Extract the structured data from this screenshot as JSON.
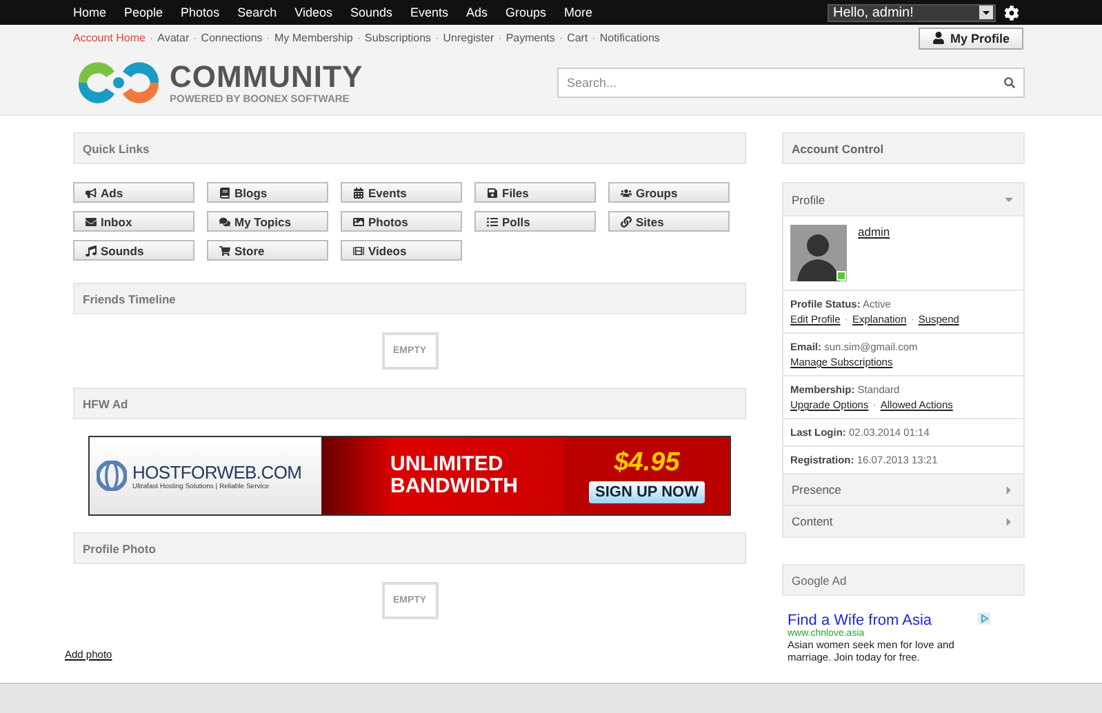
{
  "top_menu": {
    "items": [
      {
        "label": "Home"
      },
      {
        "label": "People"
      },
      {
        "label": "Photos"
      },
      {
        "label": "Search"
      },
      {
        "label": "Videos"
      },
      {
        "label": "Sounds"
      },
      {
        "label": "Events"
      },
      {
        "label": "Ads"
      },
      {
        "label": "Groups"
      },
      {
        "label": "More"
      }
    ],
    "user_select": {
      "value": "Hello, admin!"
    }
  },
  "sub_menu": {
    "items": [
      {
        "label": "Account Home",
        "selected": true
      },
      {
        "label": "Avatar",
        "selected": false
      },
      {
        "label": "Connections",
        "selected": false
      },
      {
        "label": "My Membership",
        "selected": false
      },
      {
        "label": "Subscriptions",
        "selected": false
      },
      {
        "label": "Unregister",
        "selected": false
      },
      {
        "label": "Payments",
        "selected": false
      },
      {
        "label": "Cart",
        "selected": false
      },
      {
        "label": "Notifications",
        "selected": false
      }
    ],
    "separator": "·",
    "profile_button": "My Profile"
  },
  "header": {
    "logo_title": "COMMUNITY",
    "logo_subtitle": "POWERED BY BOONEX SOFTWARE",
    "search": {
      "placeholder": "Search..."
    }
  },
  "quick_links": {
    "title": "Quick Links",
    "items": [
      {
        "label": "Ads"
      },
      {
        "label": "Blogs"
      },
      {
        "label": "Events"
      },
      {
        "label": "Files"
      },
      {
        "label": "Groups"
      },
      {
        "label": "Inbox"
      },
      {
        "label": "My Topics"
      },
      {
        "label": "Photos"
      },
      {
        "label": "Polls"
      },
      {
        "label": "Sites"
      },
      {
        "label": "Sounds"
      },
      {
        "label": "Store"
      },
      {
        "label": "Videos"
      }
    ]
  },
  "friends_timeline": {
    "title": "Friends Timeline",
    "empty": "EMPTY"
  },
  "hfw_ad": {
    "title": "HFW Ad",
    "banner": {
      "brand": "HOSTFORWEB.COM",
      "tagline": "Ultrafast Hosting Solutions | Reliable Service",
      "line_1": "UNLIMITED",
      "line_2": "BANDWIDTH",
      "price": "$4.95",
      "button": "SIGN UP NOW"
    }
  },
  "profile_photo": {
    "title": "Profile Photo",
    "empty": "EMPTY",
    "add_link": "Add photo"
  },
  "account_control": {
    "title": "Account Control",
    "sections": [
      {
        "title": "Profile",
        "expanded": true
      },
      {
        "title": "Presence",
        "expanded": false
      },
      {
        "title": "Content",
        "expanded": false
      }
    ],
    "profile": {
      "username": "admin",
      "online": true,
      "link_separator": "·",
      "rows": [
        {
          "label": "Profile Status:",
          "value": "Active",
          "links": [
            "Edit Profile",
            "Explanation",
            "Suspend"
          ]
        },
        {
          "label": "Email:",
          "value": "sun.sim@gmail.com",
          "links": [
            "Manage Subscriptions"
          ]
        },
        {
          "label": "Membership:",
          "value": "Standard",
          "links": [
            "Upgrade Options",
            "Allowed Actions"
          ]
        },
        {
          "label": "Last Login:",
          "value": "02.03.2014 01:14"
        },
        {
          "label": "Registration:",
          "value": "16.07.2013 13:21"
        }
      ]
    }
  },
  "google_ad": {
    "title": "Google Ad",
    "headline": "Find a Wife from Asia",
    "url": "www.chnlove.asia",
    "text": "Asian women seek men for love and marriage. Join today for free."
  }
}
